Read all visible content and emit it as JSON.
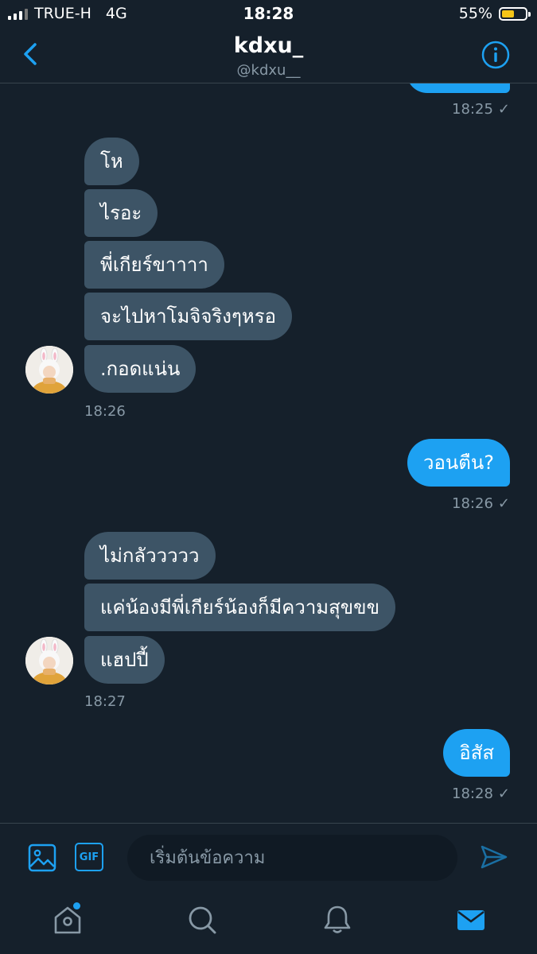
{
  "status_bar": {
    "carrier": "TRUE-H",
    "network": "4G",
    "time": "18:28",
    "battery": "55%",
    "battery_level": 0.55,
    "battery_color": "#f5c518"
  },
  "header": {
    "title": "kdxu_",
    "handle": "@kdxu__",
    "back_icon": "back-chevron-icon",
    "info_icon": "info-icon"
  },
  "messages": {
    "partial_sent": {
      "time": "18:25"
    },
    "group1": {
      "texts": [
        "โห",
        "ไรอะ",
        "พี่เกียร์ขาาาา",
        "จะไปหาโมจิจริงๆหรอ",
        ".กอดแน่น"
      ],
      "time": "18:26"
    },
    "sent1": {
      "text": "วอนตืน?",
      "time": "18:26"
    },
    "group2": {
      "texts": [
        "ไม่กลัววววว",
        "แค่น้องมีพี่เกียร์น้องก็มีความสุขขข",
        "แฮปปี้"
      ],
      "time": "18:27"
    },
    "sent2": {
      "text": "อิสัส",
      "time": "18:28"
    },
    "check_glyph": "✓"
  },
  "composer": {
    "placeholder": "เริ่มต้นข้อความ",
    "gif_label": "GIF",
    "icons": [
      "image-icon",
      "gif-icon",
      "send-icon"
    ]
  },
  "tabs": {
    "items": [
      "home-icon",
      "search-icon",
      "notifications-icon",
      "messages-icon"
    ],
    "accent": "#1da1f2"
  },
  "colors": {
    "background": "#15202b",
    "incoming_bubble": "#3d5466",
    "outgoing_bubble": "#1da1f2",
    "muted_text": "#8899a6"
  }
}
